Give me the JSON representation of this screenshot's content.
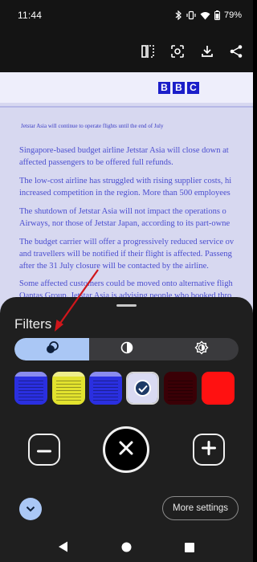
{
  "status_bar": {
    "time": "11:44",
    "battery_percent": "79%",
    "icons": [
      "bluetooth-icon",
      "vibrate-icon",
      "wifi-icon",
      "battery-icon"
    ]
  },
  "toolbar": {
    "icons": [
      "split-view-icon",
      "lens-capture-icon",
      "download-icon",
      "share-icon"
    ]
  },
  "document": {
    "logo_letters": [
      "B",
      "B",
      "C"
    ],
    "caption": "Jetstar Asia will continue to operate flights until the end of July",
    "paragraphs": [
      [
        "Singapore-based budget airline Jetstar Asia will close down at",
        "affected passengers to be offered full refunds."
      ],
      [
        "The low-cost airline has struggled with rising supplier costs, hi",
        "increased competition in the region. More than 500 employees"
      ],
      [
        "The shutdown of Jetstar Asia will not impact the operations o",
        "Airways, nor those of Jetstar Japan, according to its part-owne"
      ],
      [
        "The budget carrier will offer a progressively reduced service ov",
        "and travellers will be notified if their flight is affected. Passeng",
        "after the 31 July closure will be contacted by the airline."
      ],
      [
        "Some affected customers could be moved onto alternative fligh",
        "Qantas Group. Jetstar Asia is advising people who booked thro"
      ]
    ]
  },
  "filters_sheet": {
    "title": "Filters",
    "tabs": [
      {
        "icon": "color-filter-icon",
        "active": true
      },
      {
        "icon": "contrast-icon",
        "active": false
      },
      {
        "icon": "brightness-icon",
        "active": false
      }
    ],
    "color_options": [
      {
        "color": "#2a2fe0",
        "selected": false
      },
      {
        "color": "#e2e22e",
        "selected": false
      },
      {
        "color": "#2a2fe0",
        "selected": false
      },
      {
        "color": "#d9daf2",
        "selected": true
      },
      {
        "color": "#3a0006",
        "selected": false
      },
      {
        "color": "#ff1111",
        "selected": false
      }
    ],
    "more_settings_label": "More settings"
  },
  "colors": {
    "accent": "#aac7f5",
    "sheet_background": "#1f1f1f",
    "annotation_arrow": "#d0161b"
  }
}
